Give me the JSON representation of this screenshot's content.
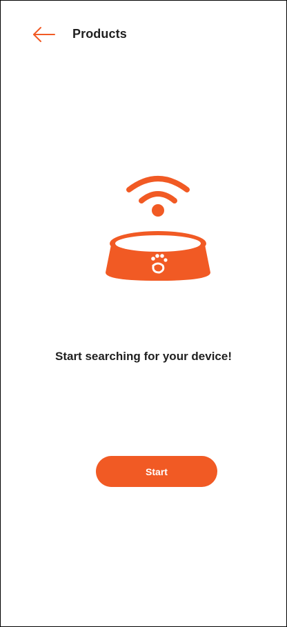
{
  "header": {
    "title": "Products",
    "back_icon": "arrow-left-icon"
  },
  "hero": {
    "icons": [
      "wifi-signal-icon",
      "pet-bowl-icon",
      "paw-icon"
    ]
  },
  "main": {
    "message": "Start searching for your device!"
  },
  "actions": {
    "start_label": "Start"
  },
  "colors": {
    "accent": "#F15A24",
    "text": "#1F1F1F",
    "background": "#FFFFFF"
  }
}
